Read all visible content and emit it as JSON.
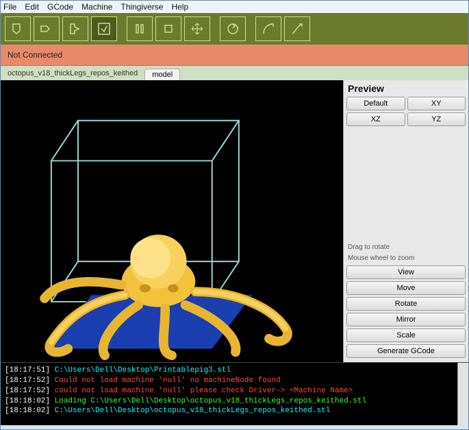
{
  "menu": {
    "items": [
      "File",
      "Edit",
      "GCode",
      "Machine",
      "Thingiverse",
      "Help"
    ]
  },
  "toolbar": {
    "icons": [
      "load-icon",
      "export-icon",
      "next-icon",
      "build-icon",
      "pause-icon",
      "stop-icon",
      "move-icon",
      "reset-icon",
      "curve1-icon",
      "curve2-icon"
    ]
  },
  "status": {
    "text": "Not Connected"
  },
  "tabs": {
    "filename": "octopus_v18_thickLegs_repos_keithed",
    "active": "model"
  },
  "preview": {
    "title": "Preview",
    "buttons": {
      "default": "Default",
      "xy": "XY",
      "xz": "XZ",
      "yz": "YZ"
    },
    "hint1": "Drag to rotate",
    "hint2": "Mouse wheel to zoom",
    "actions": [
      "View",
      "Move",
      "Rotate",
      "Mirror",
      "Scale",
      "Generate GCode"
    ]
  },
  "console": {
    "lines": [
      {
        "ts": "[18:17:51]",
        "cls": "cy",
        "text": " C:\\Users\\Dell\\Desktop\\Printablepig3.stl"
      },
      {
        "ts": "[18:17:52]",
        "cls": "rd",
        "text": " Could not load machine 'null' no machineNode found"
      },
      {
        "ts": "[18:17:52]",
        "cls": "rd",
        "text": " could not load machine 'null' please check Driver-> <Machine Name>"
      },
      {
        "ts": "[18:18:02]",
        "cls": "gr",
        "text": " Loading C:\\Users\\Dell\\Desktop\\octopus_v18_thickLegs_repos_keithed.stl"
      },
      {
        "ts": "[18:18:02]",
        "cls": "cy",
        "text": " C:\\Users\\Dell\\Desktop\\octopus_v18_thickLegs_repos_keithed.stl"
      }
    ]
  }
}
